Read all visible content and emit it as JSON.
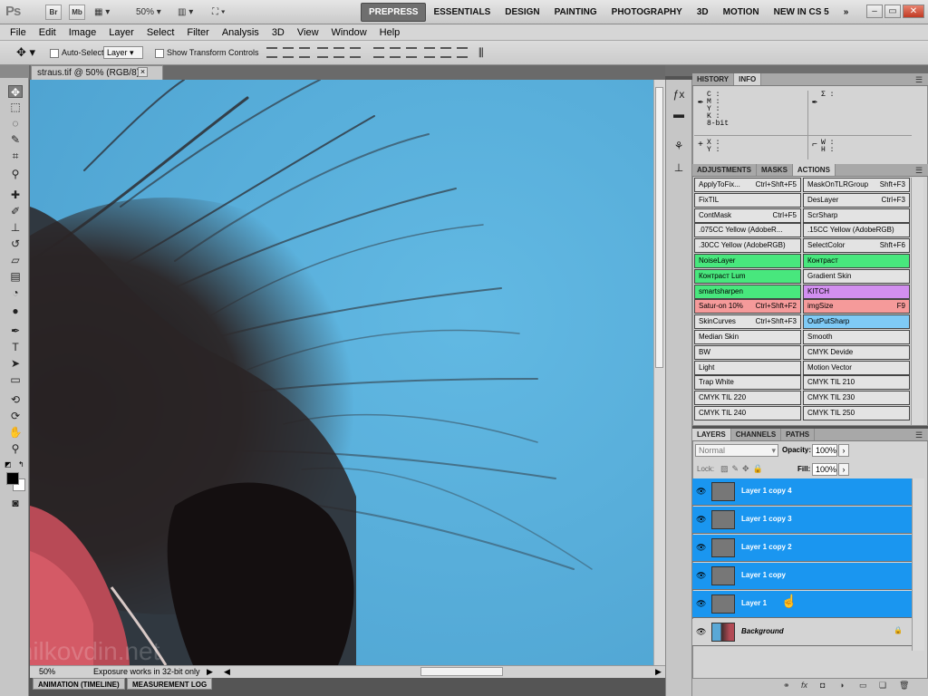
{
  "app": {
    "logo": "Ps",
    "zoom": "50%"
  },
  "appbar": {
    "br": "Br",
    "mb": "Mb"
  },
  "workspaces": [
    "PREPRESS",
    "ESSENTIALS",
    "DESIGN",
    "PAINTING",
    "PHOTOGRAPHY",
    "3D",
    "MOTION",
    "NEW IN CS 5",
    "»"
  ],
  "menus": [
    "File",
    "Edit",
    "Image",
    "Layer",
    "Select",
    "Filter",
    "Analysis",
    "3D",
    "View",
    "Window",
    "Help"
  ],
  "options": {
    "auto_select_label": "Auto-Select:",
    "auto_select_value": "Layer",
    "show_transform": "Show Transform Controls"
  },
  "document": {
    "tab_title": "straus.tif @ 50% (RGB/8) *",
    "close_glyph": "×"
  },
  "status": {
    "zoom": "50%",
    "message": "Exposure works in 32-bit only"
  },
  "bottom_tabs": [
    "ANIMATION (TIMELINE)",
    "MEASUREMENT LOG"
  ],
  "panel_info": {
    "tabs": [
      "HISTORY",
      "INFO"
    ],
    "left_top": [
      "C :",
      "M :",
      "Y :",
      "K :",
      "8-bit"
    ],
    "right_top": [
      "Σ :"
    ],
    "xy": [
      "X :",
      "Y :"
    ],
    "wh": [
      "W :",
      "H :"
    ]
  },
  "panel_actions": {
    "tabs": [
      "ADJUSTMENTS",
      "MASKS",
      "ACTIONS"
    ],
    "colors": {
      "gray": "#e3e3e3",
      "green": "#48e77d",
      "violet": "#d28ff0",
      "red": "#f59a9a",
      "blue": "#7fcaf5"
    },
    "items": [
      {
        "name": "ApplyToFix...",
        "key": "Ctrl+Shft+F5",
        "color": "gray"
      },
      {
        "name": "MaskOnTLRGroup",
        "key": "Shft+F3",
        "color": "gray"
      },
      {
        "name": "FixTIL",
        "key": "",
        "color": "gray"
      },
      {
        "name": "DesLayer",
        "key": "Ctrl+F3",
        "color": "gray"
      },
      {
        "name": "ContMask",
        "key": "Ctrl+F5",
        "color": "gray"
      },
      {
        "name": "ScrSharp",
        "key": "",
        "color": "gray"
      },
      {
        "name": ".075CC Yellow (AdobeR...",
        "key": "",
        "color": "gray"
      },
      {
        "name": ".15CC Yellow (AdobeRGB)",
        "key": "",
        "color": "gray"
      },
      {
        "name": ".30CC Yellow (AdobeRGB)",
        "key": "",
        "color": "gray"
      },
      {
        "name": "SelectColor",
        "key": "Shft+F6",
        "color": "gray"
      },
      {
        "name": "NoiseLayer",
        "key": "",
        "color": "green"
      },
      {
        "name": "Контраст",
        "key": "",
        "color": "green"
      },
      {
        "name": "Контраст Lum",
        "key": "",
        "color": "green"
      },
      {
        "name": "Gradient Skin",
        "key": "",
        "color": "gray"
      },
      {
        "name": "smartsharpen",
        "key": "",
        "color": "green"
      },
      {
        "name": "KITCH",
        "key": "",
        "color": "violet"
      },
      {
        "name": "Satur-on 10%",
        "key": "Ctrl+Shft+F2",
        "color": "red"
      },
      {
        "name": "imgSize",
        "key": "F9",
        "color": "red"
      },
      {
        "name": "SkinCurves",
        "key": "Ctrl+Shft+F3",
        "color": "gray"
      },
      {
        "name": "OutPutSharp",
        "key": "",
        "color": "blue"
      },
      {
        "name": "Median Skin",
        "key": "",
        "color": "gray"
      },
      {
        "name": "Smooth",
        "key": "",
        "color": "gray"
      },
      {
        "name": "BW",
        "key": "",
        "color": "gray"
      },
      {
        "name": "CMYK Devide",
        "key": "",
        "color": "gray"
      },
      {
        "name": "Light",
        "key": "",
        "color": "gray"
      },
      {
        "name": "Motion Vector",
        "key": "",
        "color": "gray"
      },
      {
        "name": "Trap White",
        "key": "",
        "color": "gray"
      },
      {
        "name": "CMYK TIL 210",
        "key": "",
        "color": "gray"
      },
      {
        "name": "CMYK TIL 220",
        "key": "",
        "color": "gray"
      },
      {
        "name": "CMYK TIL 230",
        "key": "",
        "color": "gray"
      },
      {
        "name": "CMYK TIL 240",
        "key": "",
        "color": "gray"
      },
      {
        "name": "CMYK TIL 250",
        "key": "",
        "color": "gray"
      }
    ]
  },
  "panel_layers": {
    "tabs": [
      "LAYERS",
      "CHANNELS",
      "PATHS"
    ],
    "blend_mode": "Normal",
    "opacity_label": "Opacity:",
    "opacity": "100%",
    "lock_label": "Lock:",
    "fill_label": "Fill:",
    "fill": "100%",
    "layers": [
      {
        "name": "Layer 1 copy 4",
        "selected": true
      },
      {
        "name": "Layer 1 copy 3",
        "selected": true
      },
      {
        "name": "Layer 1 copy 2",
        "selected": true
      },
      {
        "name": "Layer 1 copy",
        "selected": true
      },
      {
        "name": "Layer 1",
        "selected": true
      },
      {
        "name": "Background",
        "selected": false
      }
    ],
    "select_color": "#1a96f0"
  },
  "watermark": "milkovdin.net"
}
